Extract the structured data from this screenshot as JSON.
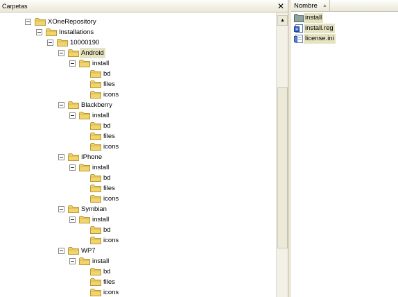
{
  "folders_pane": {
    "title": "Carpetas",
    "close_glyph": "✕"
  },
  "tree": [
    {
      "label": "XOneRepository",
      "level": 0,
      "expanded": true,
      "has_expander": true
    },
    {
      "label": "Installations",
      "level": 1,
      "expanded": true,
      "has_expander": true
    },
    {
      "label": "10000190",
      "level": 2,
      "expanded": true,
      "has_expander": true
    },
    {
      "label": "Android",
      "level": 3,
      "expanded": true,
      "has_expander": true,
      "selected": true
    },
    {
      "label": "install",
      "level": 4,
      "expanded": true,
      "has_expander": true
    },
    {
      "label": "bd",
      "level": 5,
      "has_expander": false
    },
    {
      "label": "files",
      "level": 5,
      "has_expander": false
    },
    {
      "label": "icons",
      "level": 5,
      "has_expander": false
    },
    {
      "label": "Blackberry",
      "level": 3,
      "expanded": true,
      "has_expander": true
    },
    {
      "label": "install",
      "level": 4,
      "expanded": true,
      "has_expander": true
    },
    {
      "label": "bd",
      "level": 5,
      "has_expander": false
    },
    {
      "label": "files",
      "level": 5,
      "has_expander": false
    },
    {
      "label": "icons",
      "level": 5,
      "has_expander": false
    },
    {
      "label": "IPhone",
      "level": 3,
      "expanded": true,
      "has_expander": true
    },
    {
      "label": "install",
      "level": 4,
      "expanded": true,
      "has_expander": true
    },
    {
      "label": "bd",
      "level": 5,
      "has_expander": false
    },
    {
      "label": "files",
      "level": 5,
      "has_expander": false
    },
    {
      "label": "icons",
      "level": 5,
      "has_expander": false
    },
    {
      "label": "Symbian",
      "level": 3,
      "expanded": true,
      "has_expander": true
    },
    {
      "label": "install",
      "level": 4,
      "expanded": true,
      "has_expander": true
    },
    {
      "label": "bd",
      "level": 5,
      "has_expander": false
    },
    {
      "label": "icons",
      "level": 5,
      "has_expander": false
    },
    {
      "label": "WP7",
      "level": 3,
      "expanded": true,
      "has_expander": true
    },
    {
      "label": "install",
      "level": 4,
      "expanded": true,
      "has_expander": true
    },
    {
      "label": "bd",
      "level": 5,
      "has_expander": false
    },
    {
      "label": "files",
      "level": 5,
      "has_expander": false
    },
    {
      "label": "icons",
      "level": 5,
      "has_expander": false
    }
  ],
  "list_pane": {
    "column_header": "Nombre",
    "sort_glyph": "▲",
    "items": [
      {
        "label": "install",
        "icon": "folder-icon"
      },
      {
        "label": "install.reg",
        "icon": "registry-file-icon"
      },
      {
        "label": "license.ini",
        "icon": "ini-file-icon"
      }
    ]
  },
  "scrollbar": {
    "up_glyph": "▲"
  },
  "colors": {
    "folder": "#f3d46b",
    "folder_edge": "#b89a3a",
    "selection": "#e6e3c3"
  }
}
